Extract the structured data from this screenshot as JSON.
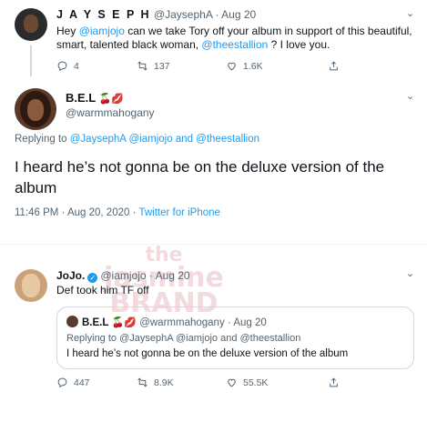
{
  "tweet1": {
    "display_name": "J A Y S E P H",
    "handle": "@JaysephA",
    "date": "Aug 20",
    "text_parts": [
      "Hey ",
      "@iamjojo",
      " can we take Tory off your album in support of this beautiful, smart, talented black woman, ",
      "@theestallion",
      " ? I love you."
    ],
    "reply_count": "4",
    "retweet_count": "137",
    "like_count": "1.6K"
  },
  "main_tweet": {
    "display_name": "B.E.L",
    "name_emojis": "🍒💋",
    "handle": "@warmmahogany",
    "replying_label": "Replying to",
    "replying_to": "@JaysephA @iamjojo and @theestallion",
    "text": "I heard he’s not gonna be on the deluxe version of the album",
    "time": "11:46 PM · Aug 20, 2020",
    "source": "Twitter for iPhone"
  },
  "jojo_tweet": {
    "display_name": "JoJo.",
    "verified_mark": "✓",
    "handle": "@iamjojo",
    "date": "Aug 20",
    "text": "Def took him TF off",
    "quote": {
      "display_name": "B.E.L",
      "name_emojis": "🍒💋",
      "handle": "@warmmahogany",
      "date": "Aug 20",
      "replying": "Replying to @JaysephA @iamjojo and @theestallion",
      "text": "I heard he’s not gonna be on the deluxe version of the album"
    },
    "reply_count": "447",
    "retweet_count": "8.9K",
    "like_count": "55.5K"
  },
  "watermark": {
    "line1": "the",
    "line2": "jasmine",
    "line3": "BRAND"
  },
  "colors": {
    "link": "#1d9bf0",
    "muted": "#536471",
    "border": "#cfd9de"
  }
}
